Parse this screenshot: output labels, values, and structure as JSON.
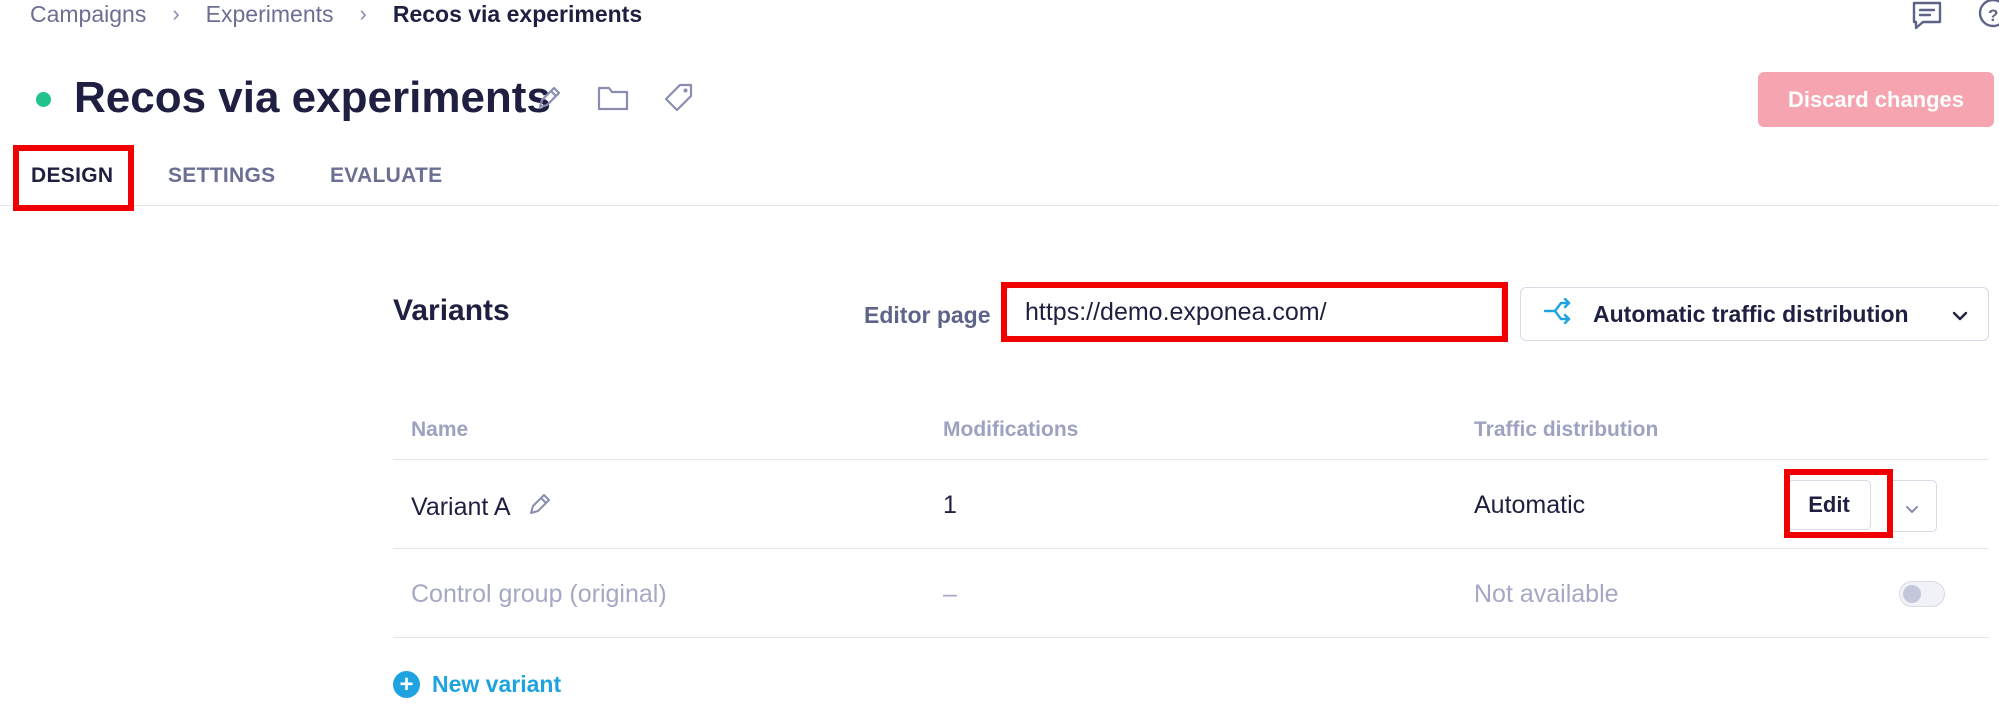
{
  "breadcrumb": {
    "items": [
      "Campaigns",
      "Experiments"
    ],
    "current": "Recos via experiments",
    "separator": "›"
  },
  "header": {
    "title": "Recos via experiments",
    "status_color": "#23c38e",
    "discard_label": "Discard changes",
    "discard_color": "#f6a4b0"
  },
  "tabs": [
    {
      "label": "DESIGN",
      "active": true
    },
    {
      "label": "SETTINGS",
      "active": false
    },
    {
      "label": "EVALUATE",
      "active": false
    }
  ],
  "variants": {
    "title": "Variants",
    "editor_label": "Editor page",
    "editor_url": "https://demo.exponea.com/",
    "traffic_mode": "Automatic traffic distribution",
    "columns": [
      "Name",
      "Modifications",
      "Traffic distribution"
    ],
    "rows": [
      {
        "name": "Variant A",
        "modifications": "1",
        "traffic": "Automatic",
        "action": "Edit"
      },
      {
        "name": "Control group (original)",
        "modifications": "–",
        "traffic": "Not available"
      }
    ],
    "new_variant_label": "New variant"
  },
  "colors": {
    "accent": "#1fa3e0",
    "highlight": "#f00000"
  },
  "icons": [
    "comment-icon",
    "help-icon",
    "pencil-icon",
    "folder-icon",
    "tag-icon",
    "split-icon",
    "chevron-down-icon",
    "plus-icon"
  ]
}
